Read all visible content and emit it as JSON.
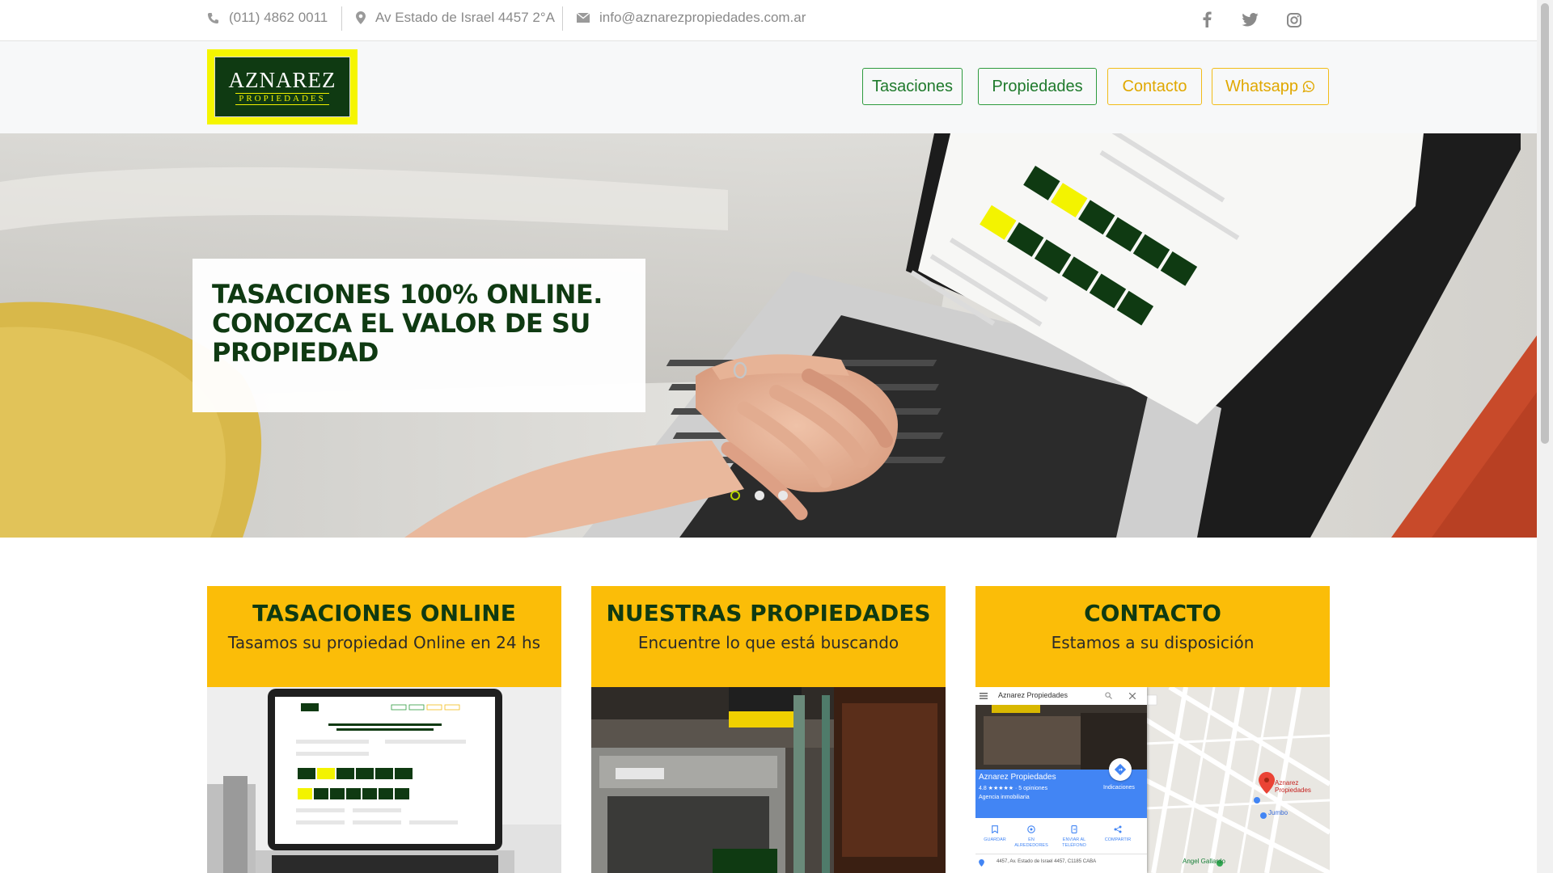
{
  "topbar": {
    "phone": "(011) 4862 0011",
    "address": "Av Estado de Israel 4457 2°A",
    "email": "info@aznarezpropiedades.com.ar",
    "social_icons": [
      "facebook-icon",
      "twitter-icon",
      "instagram-icon"
    ]
  },
  "logo": {
    "main": "AZNAREZ",
    "sub": "PROPIEDADES"
  },
  "nav": {
    "tasaciones": "Tasaciones",
    "propiedades": "Propiedades",
    "contacto": "Contacto",
    "whatsapp": "Whatsapp"
  },
  "hero": {
    "title": "TASACIONES 100% ONLINE. CONOZCA EL VALOR DE SU PROPIEDAD",
    "active_slide": 1,
    "slides": 3
  },
  "cards": [
    {
      "title": "TASACIONES ONLINE",
      "subtitle": "Tasamos su propiedad Online en 24 hs"
    },
    {
      "title": "NUESTRAS PROPIEDADES",
      "subtitle": "Encuentre lo que está buscando"
    },
    {
      "title": "CONTACTO",
      "subtitle": "Estamos a su disposición"
    }
  ],
  "map": {
    "place_name": "Aznarez Propiedades",
    "rating": "4.8 ★★★★★ · 5 opiniones",
    "category": "Agencia inmobiliaria",
    "directions": "Indicaciones",
    "actions": [
      "GUARDAR",
      "EN ALREDEDORES",
      "ENVIAR AL TELÉFONO",
      "COMPARTIR"
    ],
    "pin_label": "Aznarez Propiedades",
    "poi_1": "Jumbo",
    "poi_2": "Angel Gallardo",
    "address_line": "4457, Av. Estado de Israel 4457, C1185 CABA"
  },
  "colors": {
    "brand_green": "#0f3a12",
    "brand_yellow": "#fbbd08",
    "nav_green": "#2e9b3e",
    "nav_yellow": "#f2bc18"
  }
}
